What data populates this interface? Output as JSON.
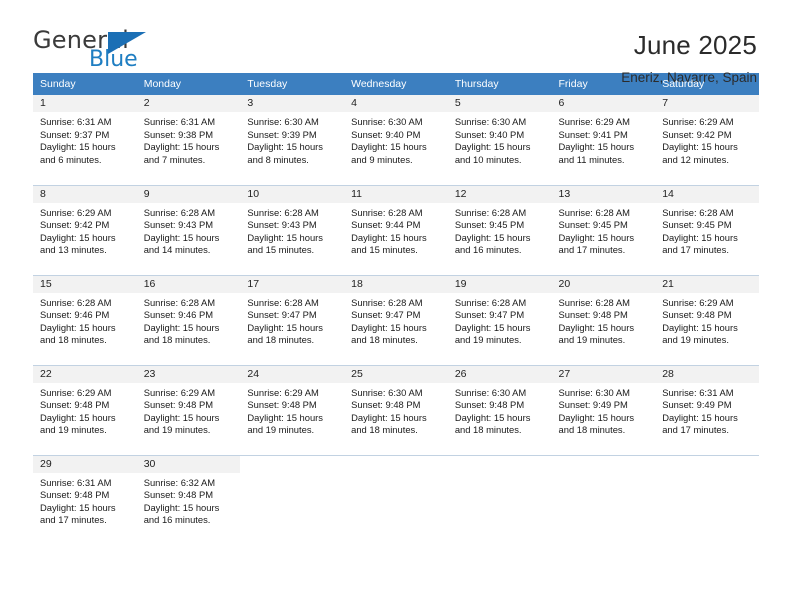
{
  "brand": {
    "name_part1": "General",
    "name_part2": "Blue",
    "flag_icon": "triangle-flag-icon"
  },
  "header": {
    "title": "June 2025",
    "subtitle": "Eneriz, Navarre, Spain"
  },
  "theme": {
    "header_blue": "#3c7fc0",
    "brand_blue": "#1f7ec2",
    "daynum_bg": "#f2f2f2",
    "grid_line": "#c2d2e2"
  },
  "weekday_headers": [
    "Sunday",
    "Monday",
    "Tuesday",
    "Wednesday",
    "Thursday",
    "Friday",
    "Saturday"
  ],
  "weeks": [
    [
      {
        "day": "1",
        "sunrise": "Sunrise: 6:31 AM",
        "sunset": "Sunset: 9:37 PM",
        "daylight1": "Daylight: 15 hours",
        "daylight2": "and 6 minutes."
      },
      {
        "day": "2",
        "sunrise": "Sunrise: 6:31 AM",
        "sunset": "Sunset: 9:38 PM",
        "daylight1": "Daylight: 15 hours",
        "daylight2": "and 7 minutes."
      },
      {
        "day": "3",
        "sunrise": "Sunrise: 6:30 AM",
        "sunset": "Sunset: 9:39 PM",
        "daylight1": "Daylight: 15 hours",
        "daylight2": "and 8 minutes."
      },
      {
        "day": "4",
        "sunrise": "Sunrise: 6:30 AM",
        "sunset": "Sunset: 9:40 PM",
        "daylight1": "Daylight: 15 hours",
        "daylight2": "and 9 minutes."
      },
      {
        "day": "5",
        "sunrise": "Sunrise: 6:30 AM",
        "sunset": "Sunset: 9:40 PM",
        "daylight1": "Daylight: 15 hours",
        "daylight2": "and 10 minutes."
      },
      {
        "day": "6",
        "sunrise": "Sunrise: 6:29 AM",
        "sunset": "Sunset: 9:41 PM",
        "daylight1": "Daylight: 15 hours",
        "daylight2": "and 11 minutes."
      },
      {
        "day": "7",
        "sunrise": "Sunrise: 6:29 AM",
        "sunset": "Sunset: 9:42 PM",
        "daylight1": "Daylight: 15 hours",
        "daylight2": "and 12 minutes."
      }
    ],
    [
      {
        "day": "8",
        "sunrise": "Sunrise: 6:29 AM",
        "sunset": "Sunset: 9:42 PM",
        "daylight1": "Daylight: 15 hours",
        "daylight2": "and 13 minutes."
      },
      {
        "day": "9",
        "sunrise": "Sunrise: 6:28 AM",
        "sunset": "Sunset: 9:43 PM",
        "daylight1": "Daylight: 15 hours",
        "daylight2": "and 14 minutes."
      },
      {
        "day": "10",
        "sunrise": "Sunrise: 6:28 AM",
        "sunset": "Sunset: 9:43 PM",
        "daylight1": "Daylight: 15 hours",
        "daylight2": "and 15 minutes."
      },
      {
        "day": "11",
        "sunrise": "Sunrise: 6:28 AM",
        "sunset": "Sunset: 9:44 PM",
        "daylight1": "Daylight: 15 hours",
        "daylight2": "and 15 minutes."
      },
      {
        "day": "12",
        "sunrise": "Sunrise: 6:28 AM",
        "sunset": "Sunset: 9:45 PM",
        "daylight1": "Daylight: 15 hours",
        "daylight2": "and 16 minutes."
      },
      {
        "day": "13",
        "sunrise": "Sunrise: 6:28 AM",
        "sunset": "Sunset: 9:45 PM",
        "daylight1": "Daylight: 15 hours",
        "daylight2": "and 17 minutes."
      },
      {
        "day": "14",
        "sunrise": "Sunrise: 6:28 AM",
        "sunset": "Sunset: 9:45 PM",
        "daylight1": "Daylight: 15 hours",
        "daylight2": "and 17 minutes."
      }
    ],
    [
      {
        "day": "15",
        "sunrise": "Sunrise: 6:28 AM",
        "sunset": "Sunset: 9:46 PM",
        "daylight1": "Daylight: 15 hours",
        "daylight2": "and 18 minutes."
      },
      {
        "day": "16",
        "sunrise": "Sunrise: 6:28 AM",
        "sunset": "Sunset: 9:46 PM",
        "daylight1": "Daylight: 15 hours",
        "daylight2": "and 18 minutes."
      },
      {
        "day": "17",
        "sunrise": "Sunrise: 6:28 AM",
        "sunset": "Sunset: 9:47 PM",
        "daylight1": "Daylight: 15 hours",
        "daylight2": "and 18 minutes."
      },
      {
        "day": "18",
        "sunrise": "Sunrise: 6:28 AM",
        "sunset": "Sunset: 9:47 PM",
        "daylight1": "Daylight: 15 hours",
        "daylight2": "and 18 minutes."
      },
      {
        "day": "19",
        "sunrise": "Sunrise: 6:28 AM",
        "sunset": "Sunset: 9:47 PM",
        "daylight1": "Daylight: 15 hours",
        "daylight2": "and 19 minutes."
      },
      {
        "day": "20",
        "sunrise": "Sunrise: 6:28 AM",
        "sunset": "Sunset: 9:48 PM",
        "daylight1": "Daylight: 15 hours",
        "daylight2": "and 19 minutes."
      },
      {
        "day": "21",
        "sunrise": "Sunrise: 6:29 AM",
        "sunset": "Sunset: 9:48 PM",
        "daylight1": "Daylight: 15 hours",
        "daylight2": "and 19 minutes."
      }
    ],
    [
      {
        "day": "22",
        "sunrise": "Sunrise: 6:29 AM",
        "sunset": "Sunset: 9:48 PM",
        "daylight1": "Daylight: 15 hours",
        "daylight2": "and 19 minutes."
      },
      {
        "day": "23",
        "sunrise": "Sunrise: 6:29 AM",
        "sunset": "Sunset: 9:48 PM",
        "daylight1": "Daylight: 15 hours",
        "daylight2": "and 19 minutes."
      },
      {
        "day": "24",
        "sunrise": "Sunrise: 6:29 AM",
        "sunset": "Sunset: 9:48 PM",
        "daylight1": "Daylight: 15 hours",
        "daylight2": "and 19 minutes."
      },
      {
        "day": "25",
        "sunrise": "Sunrise: 6:30 AM",
        "sunset": "Sunset: 9:48 PM",
        "daylight1": "Daylight: 15 hours",
        "daylight2": "and 18 minutes."
      },
      {
        "day": "26",
        "sunrise": "Sunrise: 6:30 AM",
        "sunset": "Sunset: 9:48 PM",
        "daylight1": "Daylight: 15 hours",
        "daylight2": "and 18 minutes."
      },
      {
        "day": "27",
        "sunrise": "Sunrise: 6:30 AM",
        "sunset": "Sunset: 9:49 PM",
        "daylight1": "Daylight: 15 hours",
        "daylight2": "and 18 minutes."
      },
      {
        "day": "28",
        "sunrise": "Sunrise: 6:31 AM",
        "sunset": "Sunset: 9:49 PM",
        "daylight1": "Daylight: 15 hours",
        "daylight2": "and 17 minutes."
      }
    ],
    [
      {
        "day": "29",
        "sunrise": "Sunrise: 6:31 AM",
        "sunset": "Sunset: 9:48 PM",
        "daylight1": "Daylight: 15 hours",
        "daylight2": "and 17 minutes."
      },
      {
        "day": "30",
        "sunrise": "Sunrise: 6:32 AM",
        "sunset": "Sunset: 9:48 PM",
        "daylight1": "Daylight: 15 hours",
        "daylight2": "and 16 minutes."
      },
      null,
      null,
      null,
      null,
      null
    ]
  ]
}
